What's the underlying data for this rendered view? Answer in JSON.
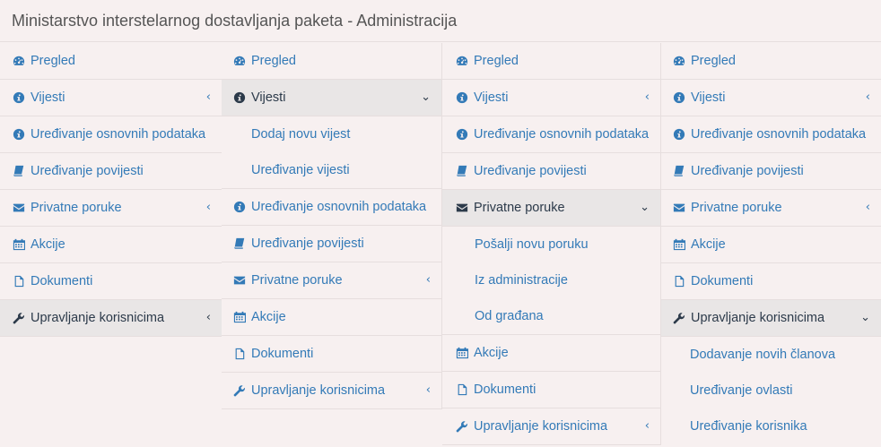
{
  "page": {
    "title": "Ministarstvo interstelarnog dostavljanja paketa - Administracija"
  },
  "menu": {
    "pregled": "Pregled",
    "vijesti": "Vijesti",
    "osnovni": "Uređivanje osnovnih podataka",
    "povijest": "Uređivanje povijesti",
    "poruke": "Privatne poruke",
    "akcije": "Akcije",
    "dokumenti": "Dokumenti",
    "korisnici": "Upravljanje korisnicima"
  },
  "submenus": {
    "vijesti": [
      "Dodaj novu vijest",
      "Uređivanje vijesti"
    ],
    "poruke": [
      "Pošalji novu poruku",
      "Iz administracije",
      "Od građana"
    ],
    "korisnici": [
      "Dodavanje novih članova",
      "Uređivanje ovlasti",
      "Uređivanje korisnika"
    ]
  },
  "icons": {
    "pregled": "dashboard-icon",
    "vijesti": "info-circle-icon",
    "osnovni": "info-circle-icon",
    "povijest": "book-icon",
    "poruke": "envelope-icon",
    "akcije": "calendar-icon",
    "dokumenti": "file-icon",
    "korisnici": "wrench-icon",
    "collapsed": "chevron-left-icon",
    "expanded": "chevron-down-icon"
  },
  "chevrons": {
    "collapsed": "‹",
    "expanded": "⌄"
  },
  "colors": {
    "link": "#337ab7",
    "active_text": "#2c3a4a",
    "active_bg": "#e9e6e6",
    "background": "#f7f0f0"
  }
}
